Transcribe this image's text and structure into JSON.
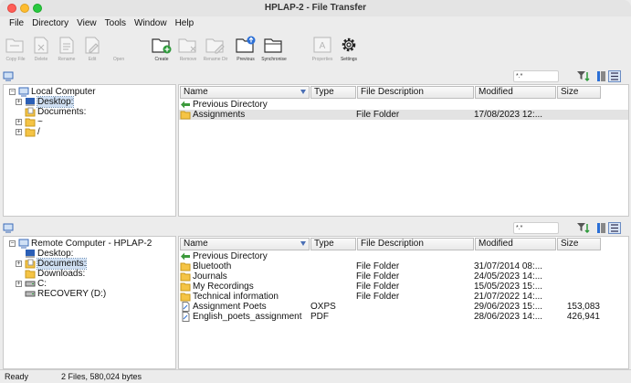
{
  "window": {
    "title": "HPLAP-2 - File Transfer"
  },
  "menu": [
    "File",
    "Directory",
    "View",
    "Tools",
    "Window",
    "Help"
  ],
  "toolbar": {
    "items": [
      {
        "label": "Copy File",
        "icon": "copy-file-icon",
        "enabled": false
      },
      {
        "label": "Delete",
        "icon": "delete-icon",
        "enabled": false
      },
      {
        "label": "Rename",
        "icon": "rename-icon",
        "enabled": false
      },
      {
        "label": "Edit",
        "icon": "edit-icon",
        "enabled": false
      },
      {
        "label": "Open",
        "icon": "open-icon",
        "enabled": false
      },
      {
        "label": "Create",
        "icon": "create-folder-icon",
        "enabled": true
      },
      {
        "label": "Remove",
        "icon": "remove-folder-icon",
        "enabled": false
      },
      {
        "label": "Rename Dir",
        "icon": "rename-dir-icon",
        "enabled": false
      },
      {
        "label": "Previous",
        "icon": "previous-folder-icon",
        "enabled": true
      },
      {
        "label": "Synchronise",
        "icon": "synchronise-icon",
        "enabled": true
      },
      {
        "label": "Properties",
        "icon": "properties-icon",
        "enabled": false
      },
      {
        "label": "Settings",
        "icon": "settings-gear-icon",
        "enabled": true
      }
    ]
  },
  "local": {
    "filter_text": "*.*",
    "tree": [
      {
        "label": "Local Computer",
        "level": 0,
        "expander": "−",
        "icon": "computer-icon"
      },
      {
        "label": "Desktop:",
        "level": 1,
        "expander": "+",
        "icon": "desktop-icon",
        "selected": true
      },
      {
        "label": "Documents:",
        "level": 1,
        "expander": "",
        "icon": "document-folder-icon"
      },
      {
        "label": "~",
        "level": 1,
        "expander": "+",
        "icon": "folder-icon"
      },
      {
        "label": "/",
        "level": 1,
        "expander": "+",
        "icon": "folder-icon"
      }
    ],
    "columns": [
      "Name",
      "Type",
      "File Description",
      "Modified",
      "Size"
    ],
    "rows": [
      {
        "name": "Previous Directory",
        "type": "",
        "desc": "",
        "modified": "",
        "size": "",
        "icon": "up-arrow-icon"
      },
      {
        "name": "Assignments",
        "type": "",
        "desc": "File Folder",
        "modified": "17/08/2023 12:...",
        "size": "",
        "icon": "folder-icon",
        "selected": true
      }
    ]
  },
  "remote": {
    "filter_text": "*.*",
    "tree": [
      {
        "label": "Remote Computer - HPLAP-2",
        "level": 0,
        "expander": "−",
        "icon": "computer-icon"
      },
      {
        "label": "Desktop:",
        "level": 1,
        "expander": "",
        "icon": "desktop-icon"
      },
      {
        "label": "Documents:",
        "level": 1,
        "expander": "+",
        "icon": "document-folder-icon",
        "selected": true
      },
      {
        "label": "Downloads:",
        "level": 1,
        "expander": "",
        "icon": "folder-icon"
      },
      {
        "label": "C:",
        "level": 1,
        "expander": "+",
        "icon": "drive-icon"
      },
      {
        "label": "RECOVERY (D:)",
        "level": 1,
        "expander": "",
        "icon": "drive-icon"
      }
    ],
    "columns": [
      "Name",
      "Type",
      "File Description",
      "Modified",
      "Size"
    ],
    "rows": [
      {
        "name": "Previous Directory",
        "type": "",
        "desc": "",
        "modified": "",
        "size": "",
        "icon": "up-arrow-icon"
      },
      {
        "name": "Bluetooth",
        "type": "",
        "desc": "File Folder",
        "modified": "31/07/2014 08:...",
        "size": "",
        "icon": "folder-icon"
      },
      {
        "name": "Journals",
        "type": "",
        "desc": "File Folder",
        "modified": "24/05/2023 14:...",
        "size": "",
        "icon": "folder-icon"
      },
      {
        "name": "My Recordings",
        "type": "",
        "desc": "File Folder",
        "modified": "15/05/2023 15:...",
        "size": "",
        "icon": "folder-icon"
      },
      {
        "name": "Technical information",
        "type": "",
        "desc": "File Folder",
        "modified": "21/07/2022 14:...",
        "size": "",
        "icon": "folder-icon"
      },
      {
        "name": "Assignment Poets",
        "type": "OXPS",
        "desc": "",
        "modified": "29/06/2023 15:...",
        "size": "153,083",
        "icon": "file-icon"
      },
      {
        "name": "English_poets_assignment",
        "type": "PDF",
        "desc": "",
        "modified": "28/06/2023 14:...",
        "size": "426,941",
        "icon": "file-icon"
      }
    ]
  },
  "status": {
    "state": "Ready",
    "summary": "2 Files, 580,024 bytes"
  }
}
